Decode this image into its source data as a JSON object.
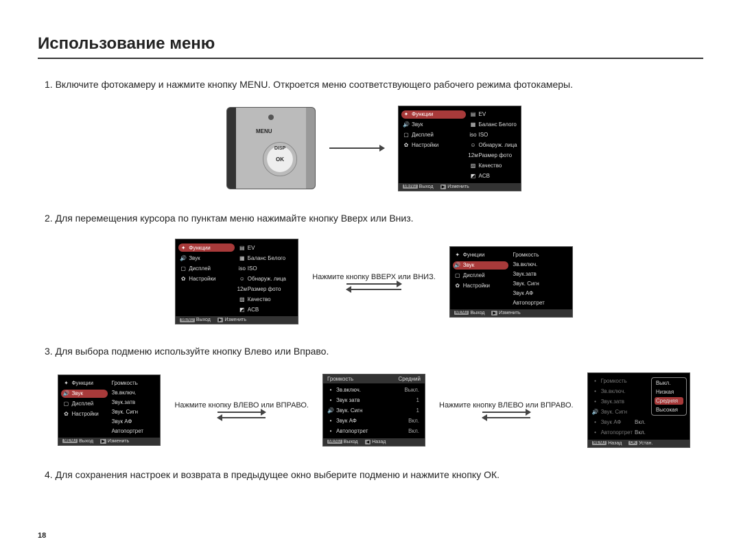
{
  "title": "Использование меню",
  "steps": {
    "s1": "1. Включите фотокамеру и нажмите кнопку MENU. Откроется меню соответствующего рабочего режима фотокамеры.",
    "s2": "2. Для перемещения курсора по пунктам меню нажимайте кнопку Вверх или Вниз.",
    "s3": "3. Для выбора подменю используйте кнопку Влево или Вправо.",
    "s4": "4. Для сохранения настроек и возврата в предыдущее окно выберите подменю и нажмите кнопку ОК."
  },
  "camera": {
    "menu": "MENU",
    "disp": "DISP",
    "ok": "OK"
  },
  "captions": {
    "updown": "Нажмите кнопку ВВЕРХ или ВНИЗ.",
    "leftright": "Нажмите кнопку ВЛЕВО или ВПРАВО."
  },
  "menuLeft": {
    "functions": "Функции",
    "sound": "Звук",
    "display": "Дисплей",
    "settings": "Настройки"
  },
  "menuRight1": {
    "ev": "EV",
    "wb": "Баланс Белого",
    "iso": "ISO",
    "face": "Обнаруж. лица",
    "size": "Размер фото",
    "size_prefix": "12м",
    "quality": "Качество",
    "acb": "ACB"
  },
  "soundSub": {
    "volume": "Громкость",
    "startup": "Зв.включ.",
    "shutter": "Звук.затв",
    "beep": "Звук. Сигн",
    "af": "Звук АФ",
    "selfportrait": "Автопортрет"
  },
  "soundDetail": {
    "header_left": "Громкость",
    "header_right": "Средний",
    "startup": "Зв.включ.",
    "startup_v": "Выкл.",
    "shutter": "Звук затв",
    "shutter_v": "1",
    "beep": "Звук. Сигн",
    "beep_v": "1",
    "af": "Звук АФ",
    "af_v": "Вкл.",
    "selfportrait": "Автопортрет",
    "selfportrait_v": "Вкл."
  },
  "volumeOpts": {
    "off": "Выкл.",
    "low": "Низкая",
    "mid": "Средняя",
    "high": "Высокая"
  },
  "dimmed": {
    "volume": "Громкость",
    "startup": "Зв.включ.",
    "shutter": "Звук.затв",
    "beep": "Звук. Сигн",
    "af": "Звук АФ",
    "selfportrait": "Автопортрет",
    "on": "Вкл."
  },
  "footer": {
    "menu": "MENU",
    "exit": "Выход",
    "ok": "OK",
    "change": "Изменить",
    "back": "Назад",
    "set": "Устан."
  },
  "pagenum": "18"
}
